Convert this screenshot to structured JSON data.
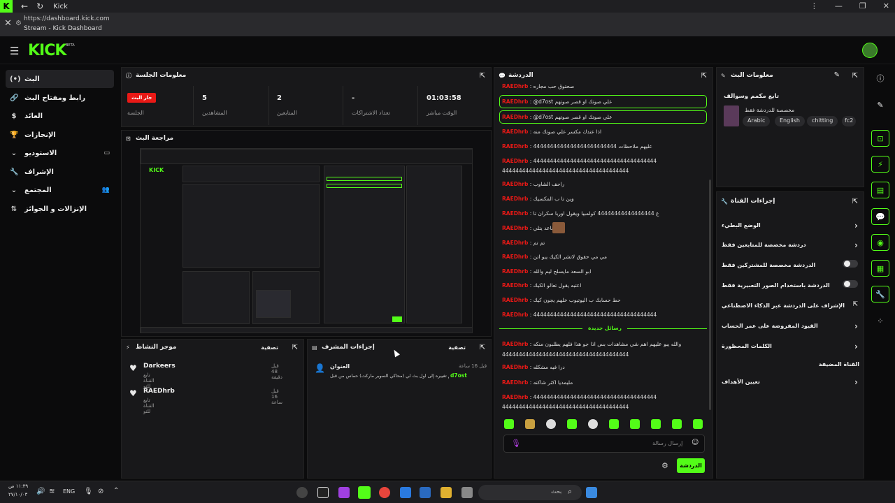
{
  "titlebar": {
    "app_title": "Kick",
    "window_controls": [
      "⋮",
      "—",
      "❐",
      "✕"
    ]
  },
  "urlbar": {
    "url": "https://dashboard.kick.com",
    "page_title": "Stream - Kick Dashboard"
  },
  "header": {
    "brand": "KICK",
    "beta": "BETA"
  },
  "sidebar": {
    "items": [
      {
        "icon": "(•)",
        "label": "البث",
        "active": true
      },
      {
        "icon": "🔗",
        "label": "رابط ومفتاح البث"
      },
      {
        "icon": "$",
        "label": "العائد"
      },
      {
        "icon": "🏆",
        "label": "الإنجازات"
      },
      {
        "icon": "⌄",
        "label": "الاستوديو",
        "right": "▭"
      },
      {
        "icon": "🔧",
        "label": "الإشراف"
      },
      {
        "icon": "⌄",
        "label": "المجتمع",
        "right": "👥"
      },
      {
        "icon": "⇅",
        "label": "الإنزالات و الجوائز"
      }
    ]
  },
  "session": {
    "title": "معلومات الجلسة",
    "live_badge": "جار البث",
    "session_label": "الجلسة",
    "viewers_value": "5",
    "viewers_label": "المشاهدين",
    "followers_value": "2",
    "followers_label": "المتابعين",
    "subs_value": "-",
    "subs_label": "تعداد الاشتراكات",
    "time_value": "01:03:58",
    "time_label": "الوقت مباشر"
  },
  "preview": {
    "title": "مراجعة البث"
  },
  "activity": {
    "title": "موجز النشاط",
    "filter": "تصفية",
    "items": [
      {
        "name": "Darkeers",
        "sub": "تابع القناة للتو",
        "time": "قبل 48 دقيقة"
      },
      {
        "name": "RAEDhrb",
        "sub": "تابع القناة للتو",
        "time": "قبل 16 ساعة"
      }
    ]
  },
  "modactions": {
    "title": "إجراءات المشرف",
    "filter": "تصفية",
    "item_title": "العنوان",
    "item_time": "قبل 16 ساعة",
    "item_text": "تم تغييره إلى اول بث لي (محاكي السوبر ماركت) حماس من قبل",
    "item_user": "d7ost"
  },
  "chat": {
    "title": "الدردشة",
    "messages": [
      {
        "user": "RAEDhrb",
        "text": "صحتوق حب مجاره"
      },
      {
        "user": "RAEDhrb",
        "text": "@d7ost علي صوتك او قصر صوتهم",
        "hl": true
      },
      {
        "user": "RAEDhrb",
        "text": "@d7ost علي صوتك او قصر صوتهم",
        "hl": true
      },
      {
        "user": "RAEDhrb",
        "text": "اذا عندك مكسر علي صوتك منه"
      },
      {
        "user": "RAEDhrb",
        "text": "4444444444444444444444444 عليهم ملاحظات"
      },
      {
        "user": "RAEDhrb",
        "text": "4444444444444444444444444444444444444"
      },
      {
        "user": "",
        "text": "44444444444444444444444444444444444444"
      },
      {
        "user": "RAEDhrb",
        "text": "راحف الشاوب"
      },
      {
        "user": "RAEDhrb",
        "text": "وين تا ب المكسيك"
      },
      {
        "user": "RAEDhrb",
        "text": "ع 44444444444444444 كولمبيا ويقول اوربا سكران تا"
      },
      {
        "user": "RAEDhrb",
        "text": "قاعد يتلي"
      },
      {
        "user": "RAEDhrb",
        "text": "تم تم"
      },
      {
        "user": "RAEDhrb",
        "text": "مي مي حقوق لاتشر الكيك يبو اتن"
      },
      {
        "user": "RAEDhrb",
        "text": "ابو السعد مايسلح ليم والله"
      },
      {
        "user": "RAEDhrb",
        "text": "اعتبه يقول تعالو الكيك"
      },
      {
        "user": "RAEDhrb",
        "text": "حط حسابك ب اليوتيوب خلهم يجون كيك"
      },
      {
        "user": "RAEDhrb",
        "text": "4444444444444444444444444444444444444"
      }
    ],
    "new_messages": "رسائل جديدة",
    "messages2": [
      {
        "user": "RAEDhrb",
        "text": "والله يبو عليهم اهم شي مشاهدات بس اذا جو هذا فلهم يطلبون منكه"
      },
      {
        "user": "",
        "text": "44444444444444444444444444444444444444"
      },
      {
        "user": "RAEDhrb",
        "text": "درا فيه مشكله"
      },
      {
        "user": "RAEDhrb",
        "text": "مليمديا اكثر شاكنه"
      },
      {
        "user": "RAEDhrb",
        "text": "4444444444444444444444444444444444444"
      },
      {
        "user": "",
        "text": "44444444444444444444444444444444444444"
      }
    ],
    "input_placeholder": "إرسال رسالة",
    "send_button": "الدردشة"
  },
  "stream_info": {
    "title": "معلومات البث",
    "stream_title": "تابع مكمم وسوالف",
    "category": "مخصصة للدردشة فقط",
    "tags": [
      "Arabic",
      "English",
      "chitting",
      "fc2"
    ]
  },
  "channel_actions": {
    "title": "إجراءات القناة",
    "rows": [
      {
        "label": "الوضع البطيء",
        "control": "chevron"
      },
      {
        "label": "دردشة مخصصة للمتابعين فقط",
        "control": "chevron"
      },
      {
        "label": "الدردشة مخصصة للمشتركين فقط",
        "control": "toggle"
      },
      {
        "label": "الدردشة باستخدام الصور التعبيرية فقط",
        "control": "toggle"
      },
      {
        "label": "الإشراف على الدردشة عبر الذكاء الاصطناعي",
        "control": "link"
      },
      {
        "label": "القيود المفروضة على عمر الحساب",
        "control": "chevron"
      },
      {
        "label": "الكلمات المحظورة",
        "control": "chevron"
      },
      {
        "label": "القناة المضيفة",
        "control": "none"
      },
      {
        "label": "تعيين الأهداف",
        "control": "chevron"
      }
    ]
  },
  "taskbar": {
    "time": "١١:٣٩ ص",
    "date": "٢٧/١٠/٠٣",
    "lang": "ENG",
    "search_placeholder": "بحث"
  },
  "colors": {
    "accent": "#53fc18",
    "danger": "#e91916",
    "panel": "#18181a"
  }
}
